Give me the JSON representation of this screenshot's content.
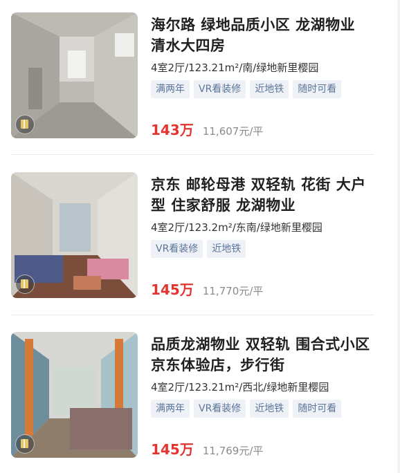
{
  "listings": [
    {
      "title": "海尔路 绿地品质小区 龙湖物业 清水大四房",
      "meta": "4室2厅/123.21m²/南/绿地新里樱园",
      "tags": [
        "满两年",
        "VR看装修",
        "近地铁",
        "随时可看"
      ],
      "price": "143万",
      "unit_price": "11,607元/平",
      "vr_icon": "vr-house-icon"
    },
    {
      "title": "京东 邮轮母港 双轻轨 花街 大户型 住家舒服 龙湖物业",
      "meta": "4室2厅/123.2m²/东南/绿地新里樱园",
      "tags": [
        "VR看装修",
        "近地铁"
      ],
      "price": "145万",
      "unit_price": "11,770元/平",
      "vr_icon": "vr-house-icon"
    },
    {
      "title": "品质龙湖物业 双轻轨 围合式小区 京东体验店，步行街",
      "meta": "4室2厅/123.21m²/西北/绿地新里樱园",
      "tags": [
        "满两年",
        "VR看装修",
        "近地铁",
        "随时可看"
      ],
      "price": "145万",
      "unit_price": "11,769元/平",
      "vr_icon": "vr-house-icon"
    }
  ],
  "colors": {
    "price": "#e3342f",
    "tag_bg": "#eef2f7",
    "tag_text": "#5b7499"
  }
}
